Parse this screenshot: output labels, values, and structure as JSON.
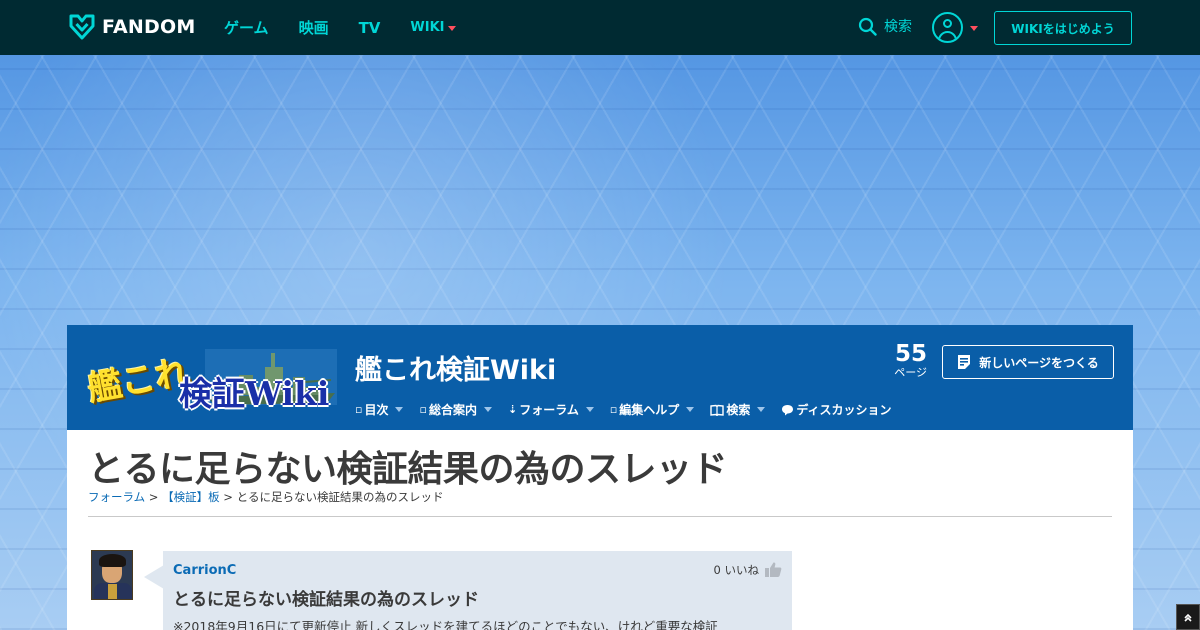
{
  "topbar": {
    "brand": "FANDOM",
    "nav": [
      {
        "label": "ゲーム"
      },
      {
        "label": "映画"
      },
      {
        "label": "TV"
      },
      {
        "label": "WIKI"
      }
    ],
    "search_label": "検索",
    "start_wiki_label": "WIKIをはじめよう",
    "accent_color": "#00d6d6",
    "background_color": "#002a32"
  },
  "community": {
    "wordmark_line1": "艦これ",
    "wordmark_line2": "検証Wiki",
    "name": "艦これ検証Wiki",
    "page_count": "55",
    "page_count_label": "ページ",
    "new_page_label": "新しいページをつくる",
    "nav": [
      {
        "label": "目次",
        "icon": "link-icon"
      },
      {
        "label": "総合案内",
        "icon": "link-icon"
      },
      {
        "label": "フォーラム",
        "icon": "link-icon"
      },
      {
        "label": "編集ヘルプ",
        "icon": "link-icon"
      },
      {
        "label": "検索",
        "icon": "book-icon"
      },
      {
        "label": "ディスカッション",
        "icon": "speech-bubble-icon"
      }
    ],
    "header_color": "#0a5ea8"
  },
  "page": {
    "title": "とるに足らない検証結果の為のスレッド",
    "breadcrumb": {
      "forum": "フォーラム",
      "sep1": " > ",
      "board": "【検証】板",
      "sep2": " > ",
      "current": "とるに足らない検証結果の為のスレッド"
    }
  },
  "post": {
    "username": "CarrionC",
    "likes": "0 いいね",
    "title": "とるに足らない検証結果の為のスレッド",
    "body": "※2018年9月16日にて更新停止 新しくスレッドを建てるほどのことでもない、けれど重要な検証"
  }
}
